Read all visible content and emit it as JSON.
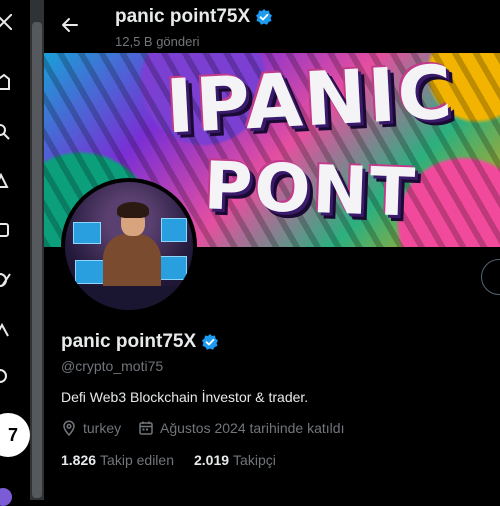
{
  "header": {
    "name": "panic point75X",
    "posts": "12,5 B gönderi",
    "verified": true
  },
  "banner": {
    "line1": "IPANIC",
    "line2": "PONT"
  },
  "profile": {
    "name": "panic point75X",
    "handle": "@crypto_moti75",
    "bio": "Defi Web3 Blockchain İnvestor & trader.",
    "location": "turkey",
    "joined": "Ağustos 2024 tarihinde katıldı",
    "following_count": "1.826",
    "following_label": "Takip edilen",
    "followers_count": "2.019",
    "followers_label": "Takipçi"
  },
  "icons": {
    "back": "arrow-left-icon",
    "verified": "verified-badge-icon",
    "location": "location-pin-icon",
    "calendar": "calendar-icon"
  },
  "colors": {
    "background": "#000000",
    "text": "#e7e9ea",
    "muted": "#71767b",
    "verified": "#1d9bf0"
  }
}
